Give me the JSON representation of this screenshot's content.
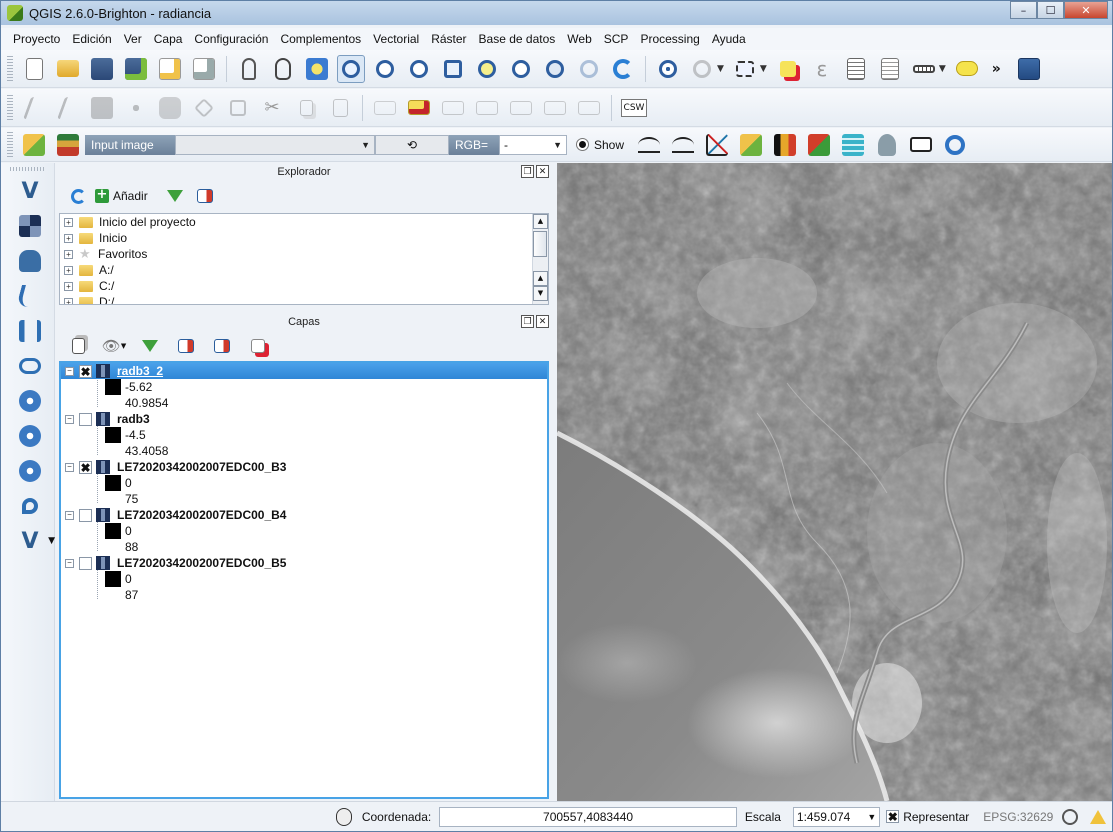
{
  "window": {
    "title": "QGIS 2.6.0-Brighton - radiancia",
    "controls": {
      "minimize": "–",
      "maximize": "☐",
      "close": "✕"
    }
  },
  "menu": [
    "Proyecto",
    "Edición",
    "Ver",
    "Capa",
    "Configuración",
    "Complementos",
    "Vectorial",
    "Ráster",
    "Base de datos",
    "Web",
    "SCP",
    "Processing",
    "Ayuda"
  ],
  "toolbar1": {
    "icons": [
      "new-project-icon",
      "open-project-icon",
      "save-project-icon",
      "save-as-icon",
      "new-print-composer-icon",
      "composer-manager-icon",
      "touch-zoom-icon",
      "pan-icon",
      "pan-to-selection-icon",
      "zoom-in-icon",
      "zoom-out-icon",
      "zoom-native-icon",
      "zoom-full-icon",
      "zoom-to-selection-icon",
      "zoom-to-layer-icon",
      "zoom-last-icon",
      "zoom-next-icon",
      "refresh-icon",
      "identify-icon",
      "action-icon",
      "select-icon",
      "deselect-icon",
      "field-calculator-icon",
      "attribute-table-icon",
      "statistics-icon",
      "measure-icon",
      "annotation-icon",
      "help-icon"
    ],
    "more": "»"
  },
  "toolbar2": {
    "icons": [
      "current-edits-icon",
      "toggle-editing-icon",
      "save-edits-icon",
      "add-feature-icon",
      "move-feature-icon",
      "node-tool-icon",
      "delete-selected-icon",
      "cut-features-icon",
      "copy-features-icon",
      "paste-features-icon",
      "label-icon",
      "label-pin-icon",
      "label-show-icon",
      "label-move-icon",
      "label-rotate-icon",
      "label-change-icon",
      "csw-icon"
    ],
    "csw_label": "CSW"
  },
  "scp_toolbar": {
    "input_label": "Input image",
    "input_value": "",
    "refresh_symbol": "⟲",
    "rgb_label": "RGB=",
    "rgb_value": "-",
    "show_label": "Show"
  },
  "browser_panel": {
    "title": "Explorador",
    "add_label": "Añadir",
    "items": [
      "Inicio del proyecto",
      "Inicio",
      "Favoritos",
      "A:/",
      "C:/",
      "D:/"
    ]
  },
  "layers_panel": {
    "title": "Capas",
    "layers": [
      {
        "name": "radb3_2",
        "checked": "✖",
        "selected": true,
        "min": "-5.62",
        "max": "40.9854"
      },
      {
        "name": "radb3",
        "checked": "",
        "selected": false,
        "min": "-4.5",
        "max": "43.4058"
      },
      {
        "name": "LE72020342002007EDC00_B3",
        "checked": "✖",
        "selected": false,
        "min": "0",
        "max": "75"
      },
      {
        "name": "LE72020342002007EDC00_B4",
        "checked": "",
        "selected": false,
        "min": "0",
        "max": "88"
      },
      {
        "name": "LE72020342002007EDC00_B5",
        "checked": "",
        "selected": false,
        "min": "0",
        "max": "87"
      }
    ]
  },
  "statusbar": {
    "coord_label": "Coordenada:",
    "coord_value": "700557,4083440",
    "scale_label": "Escala",
    "scale_value": "1:459.074",
    "render_check": "✖",
    "render_label": "Representar",
    "crs": "EPSG:32629"
  },
  "colors": {
    "selection": "#3a92df",
    "titlebar": "#b8cde6",
    "panel_bg": "#eef2f7"
  }
}
